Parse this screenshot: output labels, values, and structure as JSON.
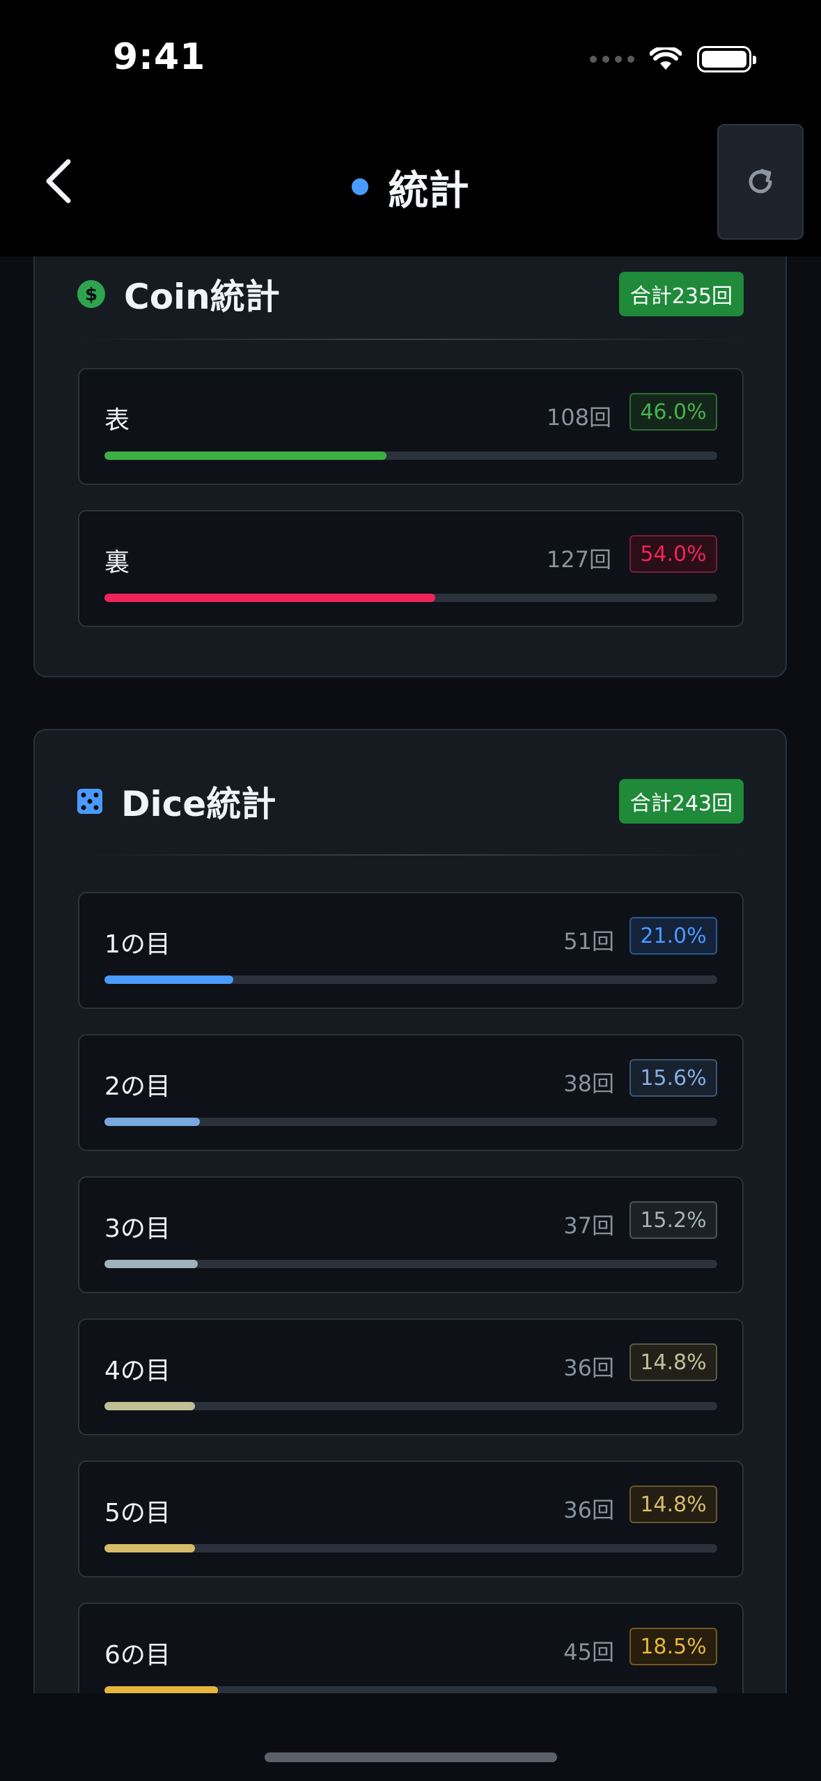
{
  "status_bar": {
    "time": "9:41"
  },
  "nav": {
    "title": "統計",
    "dot_color": "#4a9bff"
  },
  "coin": {
    "title": "Coin統計",
    "total": "合計235回",
    "rows": [
      {
        "label": "表",
        "count": "108回",
        "pct": "46.0%",
        "value": 0.46,
        "color": "#3cb043"
      },
      {
        "label": "裏",
        "count": "127回",
        "pct": "54.0%",
        "value": 0.54,
        "color": "#f0245c"
      }
    ]
  },
  "dice": {
    "title": "Dice統計",
    "total": "合計243回",
    "rows": [
      {
        "label": "1の目",
        "count": "51回",
        "pct": "21.0%",
        "value": 0.21,
        "color": "#4a9bff"
      },
      {
        "label": "2の目",
        "count": "38回",
        "pct": "15.6%",
        "value": 0.156,
        "color": "#78a8e0"
      },
      {
        "label": "3の目",
        "count": "37回",
        "pct": "15.2%",
        "value": 0.152,
        "color": "#9fb3bd"
      },
      {
        "label": "4の目",
        "count": "36回",
        "pct": "14.8%",
        "value": 0.148,
        "color": "#c1bf96"
      },
      {
        "label": "5の目",
        "count": "36回",
        "pct": "14.8%",
        "value": 0.148,
        "color": "#d8bc6a"
      },
      {
        "label": "6の目",
        "count": "45回",
        "pct": "18.5%",
        "value": 0.185,
        "color": "#e8b53c"
      }
    ]
  },
  "colors": {
    "badge_green": "#1f8a3a",
    "card_bg": "#161b22",
    "row_bg": "#0e1117"
  }
}
